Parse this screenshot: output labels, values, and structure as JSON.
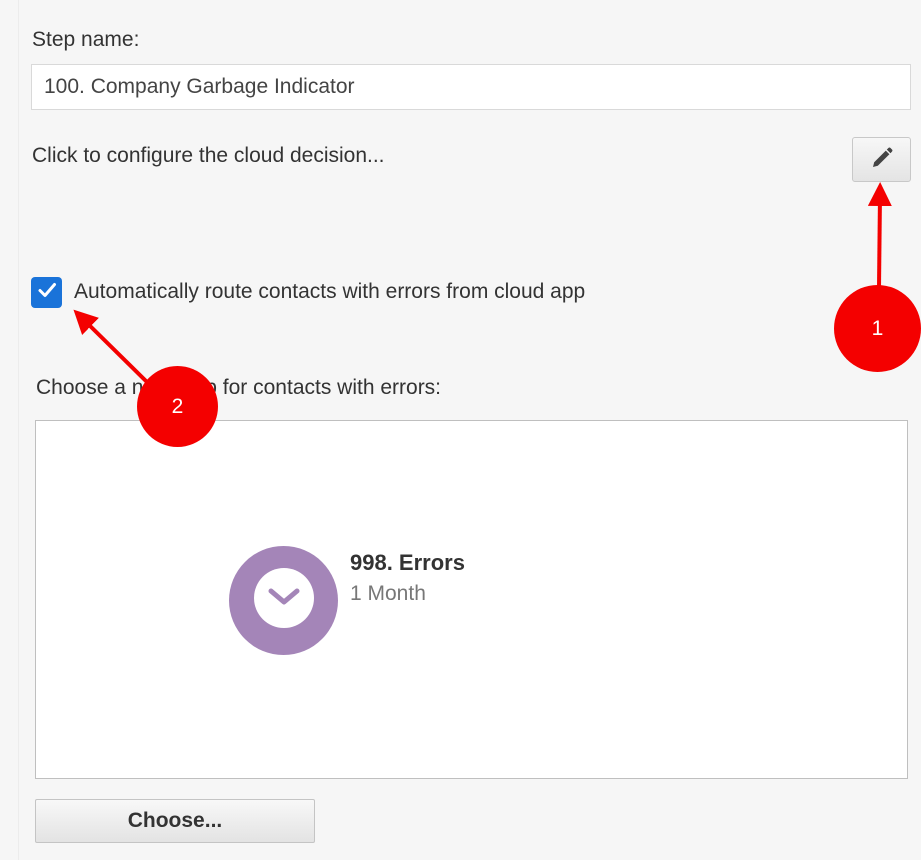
{
  "step_name": {
    "label": "Step name:",
    "value": "100. Company Garbage Indicator"
  },
  "cloud_decision": {
    "label": "Click to configure the cloud decision...",
    "edit_icon": "pencil-icon"
  },
  "auto_route": {
    "checked": true,
    "label": "Automatically route contacts with errors from cloud app"
  },
  "error_step": {
    "label": "Choose a next step for contacts with errors:",
    "node_title": "998. Errors",
    "node_subtitle": "1 Month",
    "node_icon": "clock-icon"
  },
  "choose_button": {
    "label": "Choose..."
  },
  "annotations": {
    "badge_1": "1",
    "badge_2": "2",
    "color": "#f40000"
  },
  "colors": {
    "checkbox": "#1a73d9",
    "node": "#a485b8",
    "background": "#f6f6f6"
  }
}
